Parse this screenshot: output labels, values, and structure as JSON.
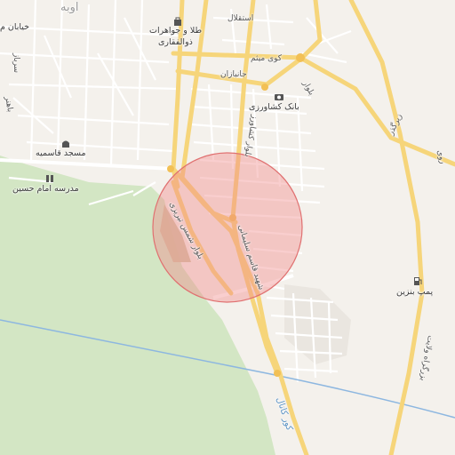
{
  "map": {
    "colors": {
      "background": "#f4f1ec",
      "green_area": "#d3e6c4",
      "major_road": "#f6d57a",
      "minor_road": "#ffffff",
      "water": "#8db7e0",
      "circle_fill": "#f08a8a",
      "circle_stroke": "#e07070"
    },
    "labels": {
      "owbeh": "اوبه",
      "khiaban_m": "خیابان م",
      "sarbaz": "سرباز",
      "bahonar": "باهنر",
      "tala": "طلا و جواهرات",
      "zolfaghari": "ذوالفقاری",
      "esteghlal": "استقلال",
      "kuye_meysam": "کوی میثم",
      "janbazan": "جانبازان",
      "bank": "بانک کشاورزی",
      "blvd_north": "بلوار",
      "blvd_keshavarz": "بلوار کشاورز",
      "zirgozar": "زیرگذر",
      "ravi": "روی",
      "masjed": "مسجد قاسمیه",
      "madreseh": "مدرسه امام حسین",
      "blvd_shams": "بلوار شمس تبریزی",
      "shahid_soleimani": "شهید قاسم سلیمانی",
      "pomp": "پمپ بنزین",
      "bozorgrah": "بزرگراه ولایت",
      "canal": "کور کانال"
    },
    "icons": {
      "shop": "shop-icon",
      "bank": "bank-icon",
      "mosque": "mosque-icon",
      "school": "school-icon",
      "fuel": "fuel-pump-icon",
      "circle": "search-radius-circle"
    }
  }
}
